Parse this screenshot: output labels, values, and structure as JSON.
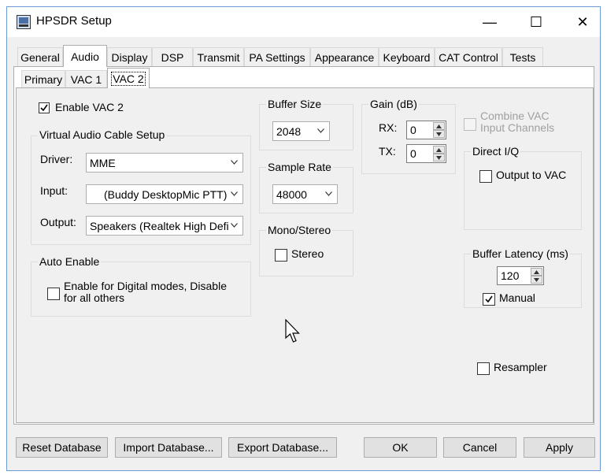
{
  "window": {
    "title": "HPSDR Setup",
    "minimize": "—",
    "maximize": "☐",
    "close": "✕"
  },
  "tabs": [
    "General",
    "Audio",
    "Display",
    "DSP",
    "Transmit",
    "PA Settings",
    "Appearance",
    "Keyboard",
    "CAT Control",
    "Tests"
  ],
  "active_tab": "Audio",
  "subtabs": [
    "Primary",
    "VAC 1",
    "VAC 2"
  ],
  "active_subtab": "VAC 2",
  "vac": {
    "enable_label": "Enable VAC 2",
    "enable_checked": true,
    "setup_label": "Virtual Audio Cable Setup",
    "driver_label": "Driver:",
    "driver_value": "MME",
    "input_label": "Input:",
    "input_value": "(Buddy DesktopMic PTT)",
    "output_label": "Output:",
    "output_value": "Speakers (Realtek High Defi"
  },
  "auto_enable": {
    "label": "Auto Enable",
    "option_line1": "Enable for Digital modes, Disable",
    "option_line2": "for all others",
    "checked": false
  },
  "buffer_size": {
    "label": "Buffer Size",
    "value": "2048"
  },
  "sample_rate": {
    "label": "Sample Rate",
    "value": "48000"
  },
  "mono_stereo": {
    "label": "Mono/Stereo",
    "stereo_label": "Stereo",
    "checked": false
  },
  "gain": {
    "label": "Gain (dB)",
    "rx_label": "RX:",
    "rx_value": "0",
    "tx_label": "TX:",
    "tx_value": "0"
  },
  "combine": {
    "line1": "Combine VAC",
    "line2": "Input Channels",
    "enabled": false
  },
  "direct_iq": {
    "label": "Direct I/Q",
    "output_label": "Output to VAC",
    "checked": false
  },
  "buffer_latency": {
    "label": "Buffer Latency (ms)",
    "value": "120",
    "manual_label": "Manual",
    "manual_checked": true
  },
  "resampler": {
    "label": "Resampler",
    "checked": false
  },
  "buttons": {
    "reset": "Reset Database",
    "import": "Import Database...",
    "export": "Export Database...",
    "ok": "OK",
    "cancel": "Cancel",
    "apply": "Apply"
  },
  "colors": {
    "border_accent": "#6c9ad6",
    "panel": "#f0f0f0",
    "disabled_text": "#a0a0a0"
  }
}
